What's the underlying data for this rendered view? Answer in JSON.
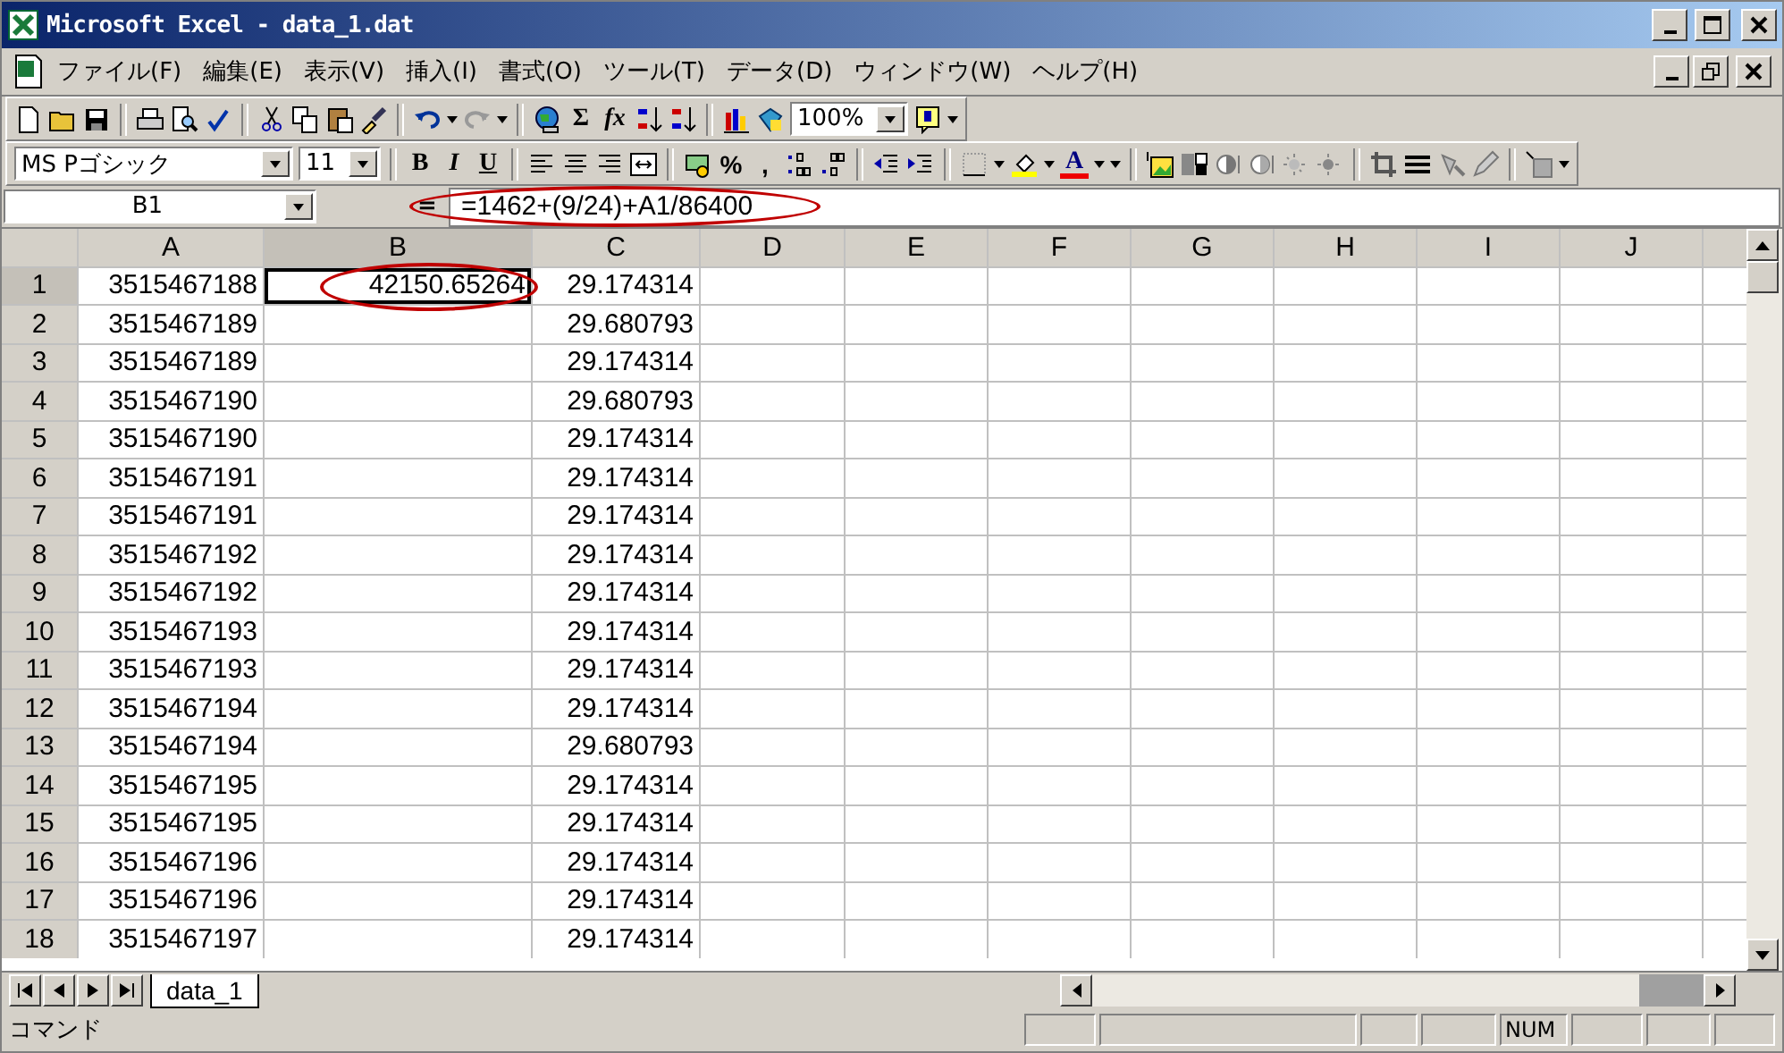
{
  "window": {
    "title": "Microsoft Excel - data_1.dat"
  },
  "menu": [
    "ファイル(F)",
    "編集(E)",
    "表示(V)",
    "挿入(I)",
    "書式(O)",
    "ツール(T)",
    "データ(D)",
    "ウィンドウ(W)",
    "ヘルプ(H)"
  ],
  "standard_toolbar": {
    "buttons": [
      "Σ",
      "fx"
    ],
    "zoom": "100%"
  },
  "formatting_toolbar": {
    "font": "MS Pゴシック",
    "size": "11",
    "buttons": [
      "B",
      "I",
      "U",
      "%",
      ",",
      "A"
    ]
  },
  "formula_bar": {
    "name_box": "B1",
    "equals": "=",
    "formula": "=1462+(9/24)+A1/86400"
  },
  "grid": {
    "columns": [
      {
        "label": "A",
        "selected": false
      },
      {
        "label": "B",
        "selected": true
      },
      {
        "label": "C",
        "selected": false
      },
      {
        "label": "D",
        "selected": false
      },
      {
        "label": "E",
        "selected": false
      },
      {
        "label": "F",
        "selected": false
      },
      {
        "label": "G",
        "selected": false
      },
      {
        "label": "H",
        "selected": false
      },
      {
        "label": "I",
        "selected": false
      },
      {
        "label": "J",
        "selected": false
      }
    ],
    "rows": [
      {
        "header": "1",
        "selected": true,
        "A": "3515467188",
        "B": "42150.65264",
        "C": "29.174314"
      },
      {
        "header": "2",
        "selected": false,
        "A": "3515467189",
        "C": "29.680793"
      },
      {
        "header": "3",
        "selected": false,
        "A": "3515467189",
        "C": "29.174314"
      },
      {
        "header": "4",
        "selected": false,
        "A": "3515467190",
        "C": "29.680793"
      },
      {
        "header": "5",
        "selected": false,
        "A": "3515467190",
        "C": "29.174314"
      },
      {
        "header": "6",
        "selected": false,
        "A": "3515467191",
        "C": "29.174314"
      },
      {
        "header": "7",
        "selected": false,
        "A": "3515467191",
        "C": "29.174314"
      },
      {
        "header": "8",
        "selected": false,
        "A": "3515467192",
        "C": "29.174314"
      },
      {
        "header": "9",
        "selected": false,
        "A": "3515467192",
        "C": "29.174314"
      },
      {
        "header": "10",
        "selected": false,
        "A": "3515467193",
        "C": "29.174314"
      },
      {
        "header": "11",
        "selected": false,
        "A": "3515467193",
        "C": "29.174314"
      },
      {
        "header": "12",
        "selected": false,
        "A": "3515467194",
        "C": "29.174314"
      },
      {
        "header": "13",
        "selected": false,
        "A": "3515467194",
        "C": "29.680793"
      },
      {
        "header": "14",
        "selected": false,
        "A": "3515467195",
        "C": "29.174314"
      },
      {
        "header": "15",
        "selected": false,
        "A": "3515467195",
        "C": "29.174314"
      },
      {
        "header": "16",
        "selected": false,
        "A": "3515467196",
        "C": "29.174314"
      },
      {
        "header": "17",
        "selected": false,
        "A": "3515467196",
        "C": "29.174314"
      },
      {
        "header": "18",
        "selected": false,
        "A": "3515467197",
        "C": "29.174314"
      }
    ]
  },
  "sheet_tabs": [
    {
      "label": "data_1",
      "selected": true
    }
  ],
  "status_bar": {
    "mode": "コマンド",
    "num_lock": "NUM"
  }
}
